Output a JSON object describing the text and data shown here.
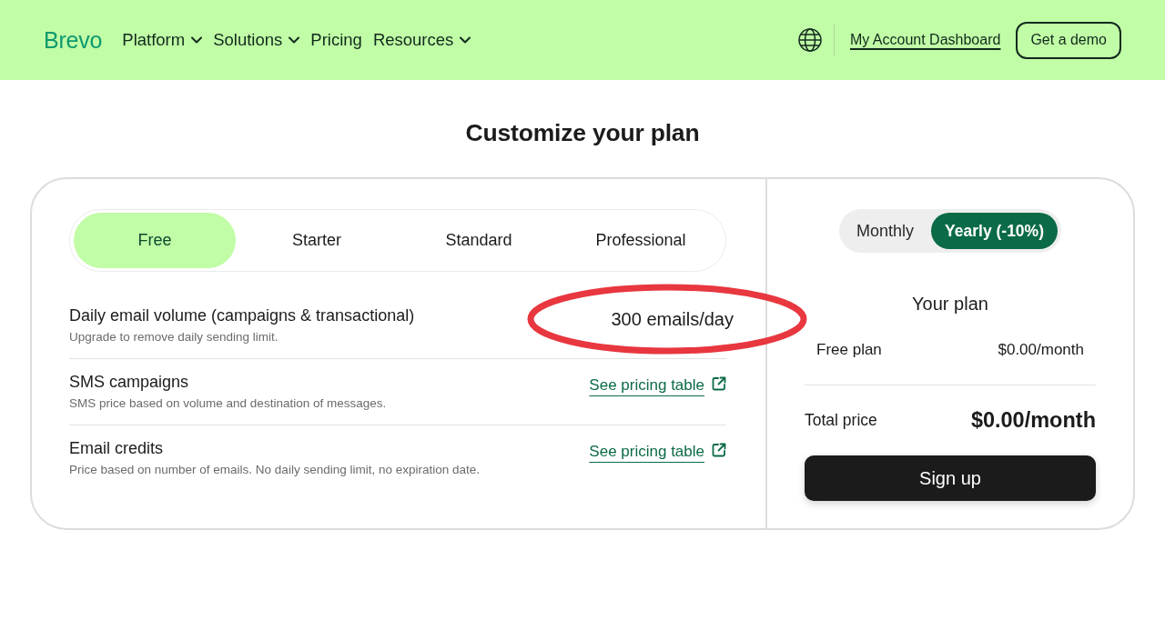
{
  "header": {
    "logo": "Brevo",
    "nav": [
      {
        "label": "Platform",
        "dropdown": true
      },
      {
        "label": "Solutions",
        "dropdown": true
      },
      {
        "label": "Pricing",
        "dropdown": false
      },
      {
        "label": "Resources",
        "dropdown": true
      }
    ],
    "account_link": "My Account Dashboard",
    "demo_button": "Get a demo"
  },
  "title": "Customize your plan",
  "plan_tabs": [
    {
      "label": "Free",
      "selected": true
    },
    {
      "label": "Starter",
      "selected": false
    },
    {
      "label": "Standard",
      "selected": false
    },
    {
      "label": "Professional",
      "selected": false
    }
  ],
  "features": [
    {
      "kind": "value",
      "title": "Daily email volume (campaigns & transactional)",
      "description": "Upgrade to remove daily sending limit.",
      "value": "300 emails/day",
      "highlighted": true
    },
    {
      "kind": "link",
      "title": "SMS campaigns",
      "description": "SMS price based on volume and destination of messages.",
      "value": "See pricing table",
      "highlighted": false
    },
    {
      "kind": "link",
      "title": "Email credits",
      "description": "Price based on number of emails. No daily sending limit, no expiration date.",
      "value": "See pricing table",
      "highlighted": false
    }
  ],
  "summary": {
    "billing": [
      {
        "label": "Monthly",
        "selected": false
      },
      {
        "label": "Yearly (-10%)",
        "selected": true
      }
    ],
    "heading": "Your plan",
    "lines": [
      {
        "label": "Free plan",
        "value": "$0.00/month"
      }
    ],
    "total": {
      "label": "Total price",
      "value": "$0.00/month"
    },
    "button": "Sign up"
  }
}
